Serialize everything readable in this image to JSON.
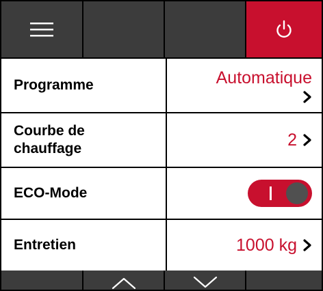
{
  "topbar": {
    "menu_icon": "hamburger-menu-icon",
    "power_icon": "power-icon",
    "power_color": "#c8102e"
  },
  "rows": [
    {
      "label": "Programme",
      "value": "Automatique"
    },
    {
      "label_line1": "Courbe de",
      "label_line2": "chauffage",
      "value": "2"
    },
    {
      "label": "ECO-Mode",
      "toggle_mark": "I",
      "toggle_on": true
    },
    {
      "label": "Entretien",
      "value": "1000 kg"
    }
  ],
  "bottombar": {
    "up_icon": "chevron-up-icon",
    "down_icon": "chevron-down-icon"
  },
  "colors": {
    "accent": "#c8102e",
    "bar": "#3c3c3c",
    "toggle_knob": "#505050"
  }
}
